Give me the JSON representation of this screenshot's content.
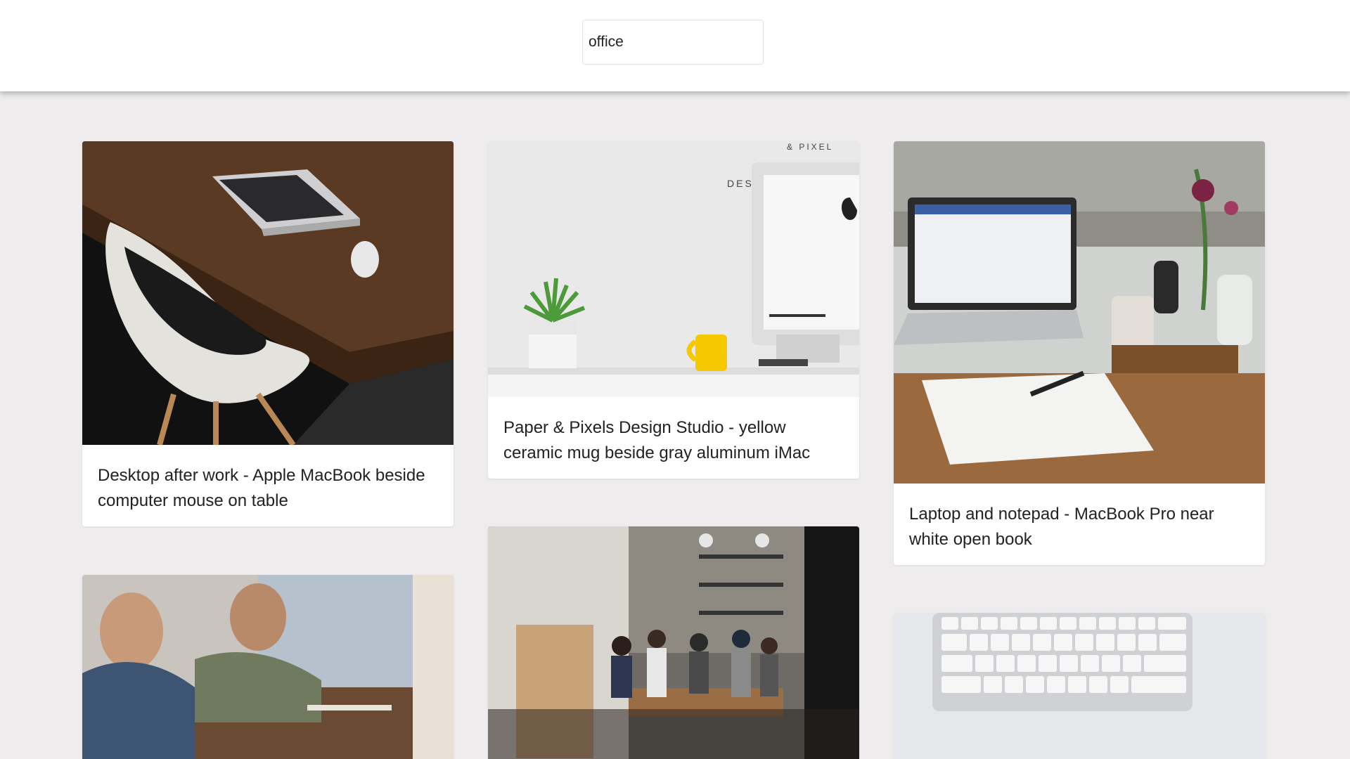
{
  "search": {
    "value": "office"
  },
  "cards": [
    {
      "caption": "Desktop after work - Apple MacBook beside computer mouse on table",
      "image": "desk-macbook-white-chair"
    },
    {
      "caption": "Paper & Pixels Design Studio - yellow ceramic mug beside gray aluminum iMac",
      "image": "imac-yellow-mug-plant"
    },
    {
      "caption": "Laptop and notepad - MacBook Pro near white open book",
      "image": "laptop-notepad-mug"
    },
    {
      "caption": "",
      "image": "team-meeting-window"
    },
    {
      "caption": "",
      "image": "cafe-office-group"
    },
    {
      "caption": "",
      "image": "white-keyboard"
    }
  ],
  "colors": {
    "background": "#eeecec",
    "card": "#ffffff",
    "text": "#222222"
  }
}
